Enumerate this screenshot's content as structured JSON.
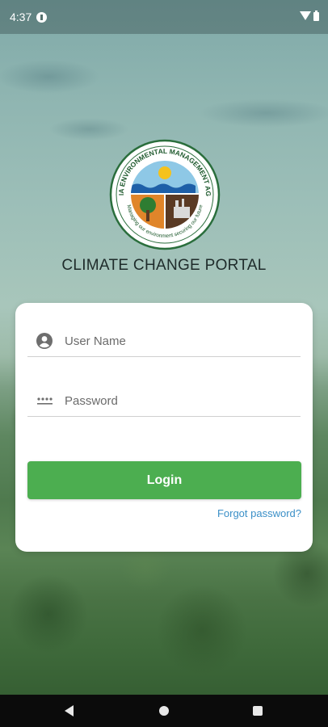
{
  "status_bar": {
    "time": "4:37",
    "icons": [
      "notification-icon",
      "wifi-icon",
      "battery-icon"
    ]
  },
  "logo": {
    "alt_name": "Zambia Environmental Management Agency logo",
    "ring_text_top": "ZAMBIA ENVIRONMENTAL MANAGEMENT AGENCY",
    "ring_text_bottom": "Managing our environment securing our future"
  },
  "title": "CLIMATE CHANGE PORTAL",
  "login_form": {
    "username_placeholder": "User Name",
    "username_value": "",
    "password_placeholder": "Password",
    "password_value": "",
    "login_label": "Login",
    "forgot_label": "Forgot password?"
  },
  "colors": {
    "primary_button": "#4cae50",
    "link": "#3a8fc7",
    "card": "#ffffff"
  },
  "nav_bar": {
    "icons": [
      "back-icon",
      "home-icon",
      "recents-icon"
    ]
  }
}
